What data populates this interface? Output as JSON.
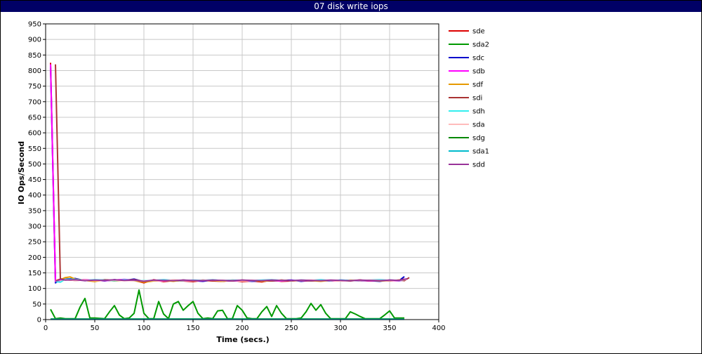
{
  "window": {
    "title": "07 disk write iops"
  },
  "chart_data": {
    "type": "line",
    "title": "07 disk write iops",
    "xlabel": "Time (secs.)",
    "ylabel": "IO Ops/Second",
    "xlim": [
      0,
      400
    ],
    "ylim": [
      0,
      950
    ],
    "x_ticks": [
      0,
      50,
      100,
      150,
      200,
      250,
      300,
      350,
      400
    ],
    "y_ticks": [
      0,
      50,
      100,
      150,
      200,
      250,
      300,
      350,
      400,
      450,
      500,
      550,
      600,
      650,
      700,
      750,
      800,
      850,
      900,
      950
    ],
    "grid": true,
    "legend_position": "right",
    "series": [
      {
        "name": "sde",
        "color": "#dd0000",
        "x": [
          5,
          10,
          15,
          20,
          30,
          40,
          50,
          60,
          70,
          80,
          90,
          100,
          110,
          120,
          130,
          140,
          150,
          160,
          170,
          180,
          190,
          200,
          210,
          220,
          230,
          240,
          250,
          260,
          270,
          280,
          290,
          300,
          310,
          320,
          330,
          340,
          350,
          360,
          365
        ],
        "y": [
          825,
          125,
          130,
          132,
          128,
          127,
          124,
          126,
          125,
          128,
          126,
          118,
          128,
          122,
          125,
          124,
          122,
          126,
          124,
          123,
          126,
          122,
          124,
          121,
          127,
          123,
          124,
          126,
          125,
          127,
          124,
          126,
          125,
          127,
          124,
          126,
          125,
          127,
          130
        ]
      },
      {
        "name": "sda2",
        "color": "#009900",
        "x": [
          5,
          10,
          15,
          20,
          30,
          35,
          40,
          45,
          50,
          55,
          60,
          65,
          70,
          75,
          80,
          85,
          90,
          95,
          100,
          105,
          110,
          115,
          120,
          125,
          130,
          135,
          140,
          145,
          150,
          155,
          160,
          165,
          170,
          175,
          180,
          185,
          190,
          195,
          200,
          205,
          210,
          215,
          220,
          225,
          230,
          235,
          240,
          245,
          250,
          255,
          260,
          265,
          270,
          275,
          280,
          285,
          290,
          295,
          300,
          305,
          310,
          315,
          320,
          325,
          330,
          335,
          340,
          345,
          350,
          355,
          360,
          365
        ],
        "y": [
          33,
          3,
          5,
          3,
          3,
          40,
          68,
          5,
          5,
          4,
          3,
          25,
          45,
          15,
          3,
          5,
          20,
          95,
          20,
          3,
          3,
          58,
          18,
          3,
          50,
          58,
          30,
          45,
          58,
          20,
          3,
          5,
          3,
          28,
          30,
          3,
          3,
          45,
          30,
          5,
          3,
          3,
          25,
          42,
          10,
          45,
          20,
          3,
          3,
          3,
          5,
          25,
          52,
          30,
          48,
          20,
          3,
          3,
          3,
          3,
          25,
          18,
          10,
          3,
          3,
          3,
          3,
          15,
          28,
          5,
          5,
          5
        ]
      },
      {
        "name": "sdc",
        "color": "#0000cc",
        "x": [
          5,
          10,
          15,
          20,
          30,
          40,
          50,
          60,
          70,
          80,
          90,
          100,
          110,
          120,
          130,
          140,
          150,
          160,
          170,
          180,
          190,
          200,
          210,
          220,
          230,
          240,
          250,
          260,
          270,
          280,
          290,
          300,
          310,
          320,
          330,
          340,
          350,
          360,
          365
        ],
        "y": [
          815,
          118,
          128,
          130,
          132,
          125,
          127,
          124,
          128,
          126,
          130,
          122,
          126,
          125,
          124,
          127,
          125,
          123,
          127,
          125,
          124,
          126,
          123,
          125,
          124,
          126,
          127,
          123,
          126,
          125,
          124,
          127,
          126,
          124,
          125,
          123,
          127,
          126,
          138
        ]
      },
      {
        "name": "sdb",
        "color": "#ff00ff",
        "x": [
          5,
          10,
          15,
          20,
          30,
          40,
          50,
          60,
          70,
          80,
          90,
          100,
          110,
          120,
          130,
          140,
          150,
          160,
          170,
          180,
          190,
          200,
          210,
          220,
          230,
          240,
          250,
          260,
          270,
          280,
          290,
          300,
          310,
          320,
          330,
          340,
          350,
          360,
          365
        ],
        "y": [
          820,
          122,
          126,
          129,
          127,
          128,
          126,
          125,
          127,
          129,
          127,
          121,
          125,
          124,
          126,
          125,
          124,
          125,
          126,
          124,
          125,
          124,
          125,
          126,
          125,
          124,
          126,
          125,
          124,
          126,
          125,
          124,
          126,
          125,
          124,
          126,
          125,
          124,
          128
        ]
      },
      {
        "name": "sdf",
        "color": "#e69900",
        "x": [
          10,
          15,
          20,
          25,
          30,
          40,
          50,
          60,
          70,
          80,
          90,
          100,
          110,
          120,
          130,
          140,
          150,
          160,
          170,
          180,
          190,
          200,
          210,
          220,
          230,
          240,
          250,
          260,
          270,
          280,
          290,
          300,
          310,
          320,
          330,
          340,
          350,
          360,
          368
        ],
        "y": [
          125,
          128,
          135,
          137,
          130,
          126,
          122,
          128,
          124,
          127,
          125,
          120,
          124,
          126,
          123,
          127,
          124,
          126,
          125,
          123,
          127,
          124,
          126,
          123,
          125,
          127,
          124,
          126,
          125,
          123,
          126,
          124,
          127,
          125,
          126,
          124,
          125,
          127,
          130
        ]
      },
      {
        "name": "sdi",
        "color": "#aa3333",
        "x": [
          10,
          15,
          20,
          30,
          40,
          50,
          60,
          70,
          80,
          90,
          100,
          110,
          120,
          130,
          140,
          150,
          160,
          170,
          180,
          190,
          200,
          210,
          220,
          230,
          240,
          250,
          260,
          270,
          280,
          290,
          300,
          310,
          320,
          330,
          340,
          350,
          360,
          365,
          370
        ],
        "y": [
          820,
          130,
          128,
          126,
          127,
          125,
          128,
          126,
          127,
          128,
          124,
          126,
          125,
          127,
          126,
          124,
          127,
          125,
          126,
          124,
          127,
          125,
          126,
          124,
          127,
          125,
          126,
          124,
          127,
          125,
          126,
          124,
          127,
          125,
          126,
          124,
          127,
          125,
          135
        ]
      },
      {
        "name": "sdh",
        "color": "#33eeee",
        "x": [
          10,
          15,
          20,
          30,
          40,
          50,
          60,
          70,
          80,
          90,
          100,
          110,
          120,
          130,
          140,
          150,
          160,
          170,
          180,
          190,
          200,
          210,
          220,
          230,
          240,
          250,
          260,
          270,
          280,
          290,
          300,
          310,
          320,
          330,
          340,
          350,
          360,
          368
        ],
        "y": [
          122,
          120,
          130,
          129,
          126,
          128,
          127,
          125,
          128,
          126,
          125,
          126,
          128,
          126,
          125,
          127,
          126,
          128,
          125,
          127,
          126,
          125,
          127,
          128,
          126,
          125,
          127,
          126,
          128,
          125,
          127,
          126,
          125,
          127,
          128,
          126,
          125,
          130
        ]
      },
      {
        "name": "sda",
        "color": "#ffbbbb",
        "x": [
          10,
          15,
          20,
          30,
          40,
          50,
          60,
          70,
          80,
          90,
          100,
          110,
          120,
          130,
          140,
          150,
          160,
          170,
          180,
          190,
          200,
          210,
          220,
          230,
          240,
          250,
          260,
          270,
          280,
          290,
          300,
          310,
          320,
          330,
          340,
          350,
          360,
          368
        ],
        "y": [
          124,
          127,
          128,
          126,
          127,
          125,
          126,
          127,
          125,
          126,
          124,
          126,
          125,
          127,
          126,
          125,
          126,
          127,
          125,
          126,
          124,
          126,
          125,
          127,
          126,
          125,
          126,
          127,
          125,
          126,
          124,
          126,
          125,
          127,
          126,
          125,
          126,
          129
        ]
      },
      {
        "name": "sdg",
        "color": "#008800",
        "x": [
          5,
          10,
          15,
          20,
          30,
          40,
          50,
          60,
          70,
          80,
          90,
          100,
          110,
          120,
          130,
          140,
          150,
          160,
          170,
          180,
          190,
          200,
          210,
          220,
          230,
          240,
          250,
          260,
          270,
          280,
          290,
          300,
          310,
          320,
          330,
          340,
          350,
          360,
          365
        ],
        "y": [
          2,
          2,
          2,
          2,
          2,
          2,
          2,
          2,
          2,
          2,
          2,
          2,
          2,
          2,
          2,
          2,
          2,
          2,
          2,
          2,
          2,
          2,
          2,
          2,
          2,
          2,
          2,
          2,
          2,
          2,
          2,
          2,
          2,
          2,
          2,
          2,
          2,
          2,
          2
        ]
      },
      {
        "name": "sda1",
        "color": "#00bbcc",
        "x": [
          5,
          10,
          15,
          20,
          30,
          40,
          50,
          60,
          70,
          80,
          90,
          100,
          110,
          120,
          130,
          140,
          150,
          160,
          170,
          180,
          190,
          200,
          210,
          220,
          230,
          240,
          250,
          260,
          270,
          280,
          290,
          300,
          310,
          320,
          330,
          340,
          350,
          360,
          365
        ],
        "y": [
          1,
          1,
          1,
          1,
          1,
          1,
          1,
          1,
          1,
          1,
          1,
          1,
          1,
          1,
          1,
          1,
          1,
          1,
          1,
          1,
          1,
          1,
          1,
          1,
          1,
          1,
          1,
          1,
          1,
          1,
          1,
          1,
          1,
          1,
          1,
          1,
          1,
          1,
          1
        ]
      },
      {
        "name": "sdd",
        "color": "#993399",
        "x": [
          10,
          15,
          20,
          30,
          40,
          50,
          60,
          70,
          80,
          90,
          100,
          110,
          120,
          130,
          140,
          150,
          160,
          170,
          180,
          190,
          200,
          210,
          220,
          230,
          240,
          250,
          260,
          270,
          280,
          290,
          300,
          310,
          320,
          330,
          340,
          350,
          360,
          368
        ],
        "y": [
          123,
          129,
          127,
          128,
          125,
          127,
          126,
          128,
          126,
          127,
          123,
          127,
          126,
          125,
          127,
          126,
          125,
          127,
          126,
          125,
          127,
          126,
          125,
          127,
          126,
          125,
          127,
          126,
          125,
          127,
          126,
          125,
          127,
          126,
          125,
          127,
          126,
          131
        ]
      }
    ]
  }
}
